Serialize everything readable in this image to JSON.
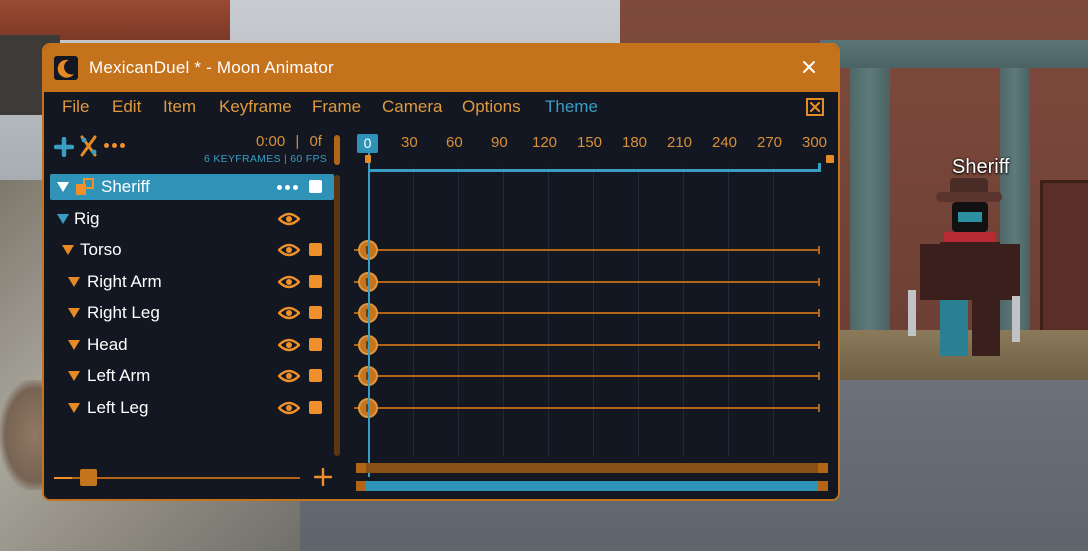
{
  "scene": {
    "npc_label": "Sheriff"
  },
  "window": {
    "title": "MexicanDuel * - Moon Animator",
    "accent": "#c5721d",
    "background": "#121721",
    "highlight": "#2f93b8"
  },
  "menu": {
    "items": [
      {
        "label": "File"
      },
      {
        "label": "Edit"
      },
      {
        "label": "Item"
      },
      {
        "label": "Keyframe"
      },
      {
        "label": "Frame"
      },
      {
        "label": "Camera"
      },
      {
        "label": "Options"
      },
      {
        "label": "Theme"
      }
    ]
  },
  "toolbar": {
    "time": "0:00",
    "separator": "|",
    "frame": "0f",
    "keyframes_info": "6 KEYFRAMES | 60 FPS"
  },
  "timeline": {
    "current_frame": "0",
    "ticks": [
      "30",
      "60",
      "90",
      "120",
      "150",
      "180",
      "210",
      "240",
      "270",
      "300"
    ]
  },
  "tree": {
    "root": {
      "label": "Sheriff",
      "icon": "rig-object-icon"
    },
    "rig": {
      "label": "Rig"
    },
    "parts": [
      {
        "label": "Torso"
      },
      {
        "label": "Right Arm"
      },
      {
        "label": "Right Leg"
      },
      {
        "label": "Head"
      },
      {
        "label": "Left Arm"
      },
      {
        "label": "Left Leg"
      }
    ]
  }
}
